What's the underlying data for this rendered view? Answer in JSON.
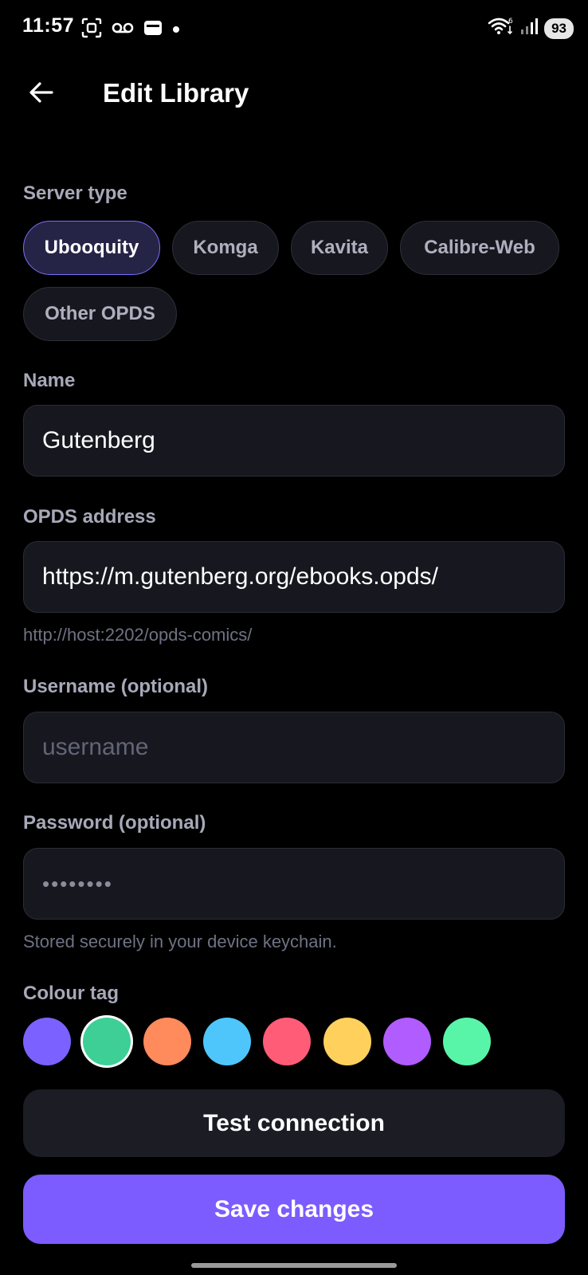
{
  "status_bar": {
    "time": "11:57",
    "battery": "93",
    "icons": [
      "face-scan-icon",
      "voicemail-icon",
      "wallet-icon",
      "dot-icon",
      "wifi-icon",
      "signal-icon",
      "battery-icon"
    ]
  },
  "header": {
    "title": "Edit Library",
    "back_icon": "arrow-left-icon"
  },
  "server_type": {
    "label": "Server type",
    "options": [
      "Ubooquity",
      "Komga",
      "Kavita",
      "Calibre-Web",
      "Other OPDS"
    ],
    "selected": "Ubooquity"
  },
  "name": {
    "label": "Name",
    "value": "Gutenberg"
  },
  "opds": {
    "label": "OPDS address",
    "value": "https://m.gutenberg.org/ebooks.opds/",
    "hint": "http://host:2202/opds-comics/"
  },
  "username": {
    "label": "Username (optional)",
    "placeholder": "username"
  },
  "password": {
    "label": "Password (optional)",
    "masked_value": "••••••••",
    "hint": "Stored securely in your device keychain."
  },
  "colour_tag": {
    "label": "Colour tag",
    "colors": [
      "#7b61ff",
      "#3ecf96",
      "#ff8a5c",
      "#4fc6fb",
      "#ff5c77",
      "#ffd15c",
      "#b05cff",
      "#58f5a8"
    ],
    "selected_index": 1
  },
  "actions": {
    "test_label": "Test connection",
    "save_label": "Save changes"
  }
}
